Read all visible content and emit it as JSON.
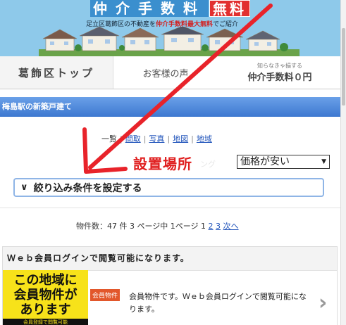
{
  "banner": {
    "title": "仲介手数料",
    "title_highlight": "無料",
    "subtitle_pre": "足立区葛飾区の不動産を",
    "subtitle_highlight": "仲介手数料最大無料",
    "subtitle_post": "でご紹介"
  },
  "nav": {
    "top_label": "葛飾区トップ",
    "voice_label": "お客様の声",
    "fee_small": "知らなきゃ損する",
    "fee_big": "仲介手数料０円"
  },
  "section_title": "梅島駅の新築戸建て",
  "views": {
    "list": "一覧",
    "floorplan": "間取",
    "photo": "写真",
    "map": "地図",
    "area": "地域"
  },
  "annotation": {
    "location_label": "設置場所",
    "ghost_text": "ング"
  },
  "sort": {
    "selected": "価格が安い"
  },
  "filter": {
    "label": "絞り込み条件を設定する"
  },
  "pager": {
    "text": "物件数：47 件 3 ページ中 1ページ 1",
    "page2": "2",
    "page3": "3",
    "next": "次へ"
  },
  "member": {
    "header": "Ｗｅｂ会員ログインで閲覧可能になります。",
    "image_line1": "この地域に",
    "image_line2": "会員物件が",
    "image_line3": "あります",
    "image_bar": "会員登録で閲覧可能",
    "badge": "会員物件",
    "description": "会員物件です。Ｗｅｂ会員ログインで閲覧可能になります。"
  },
  "colors": {
    "banner_bg": "#8ec9ea",
    "title_blue": "#3b8fce",
    "accent_red": "#e02020",
    "section_blue": "#4a86d8",
    "link_blue": "#2255bb",
    "member_yellow": "#f7e21a",
    "badge_orange": "#e2572b"
  }
}
